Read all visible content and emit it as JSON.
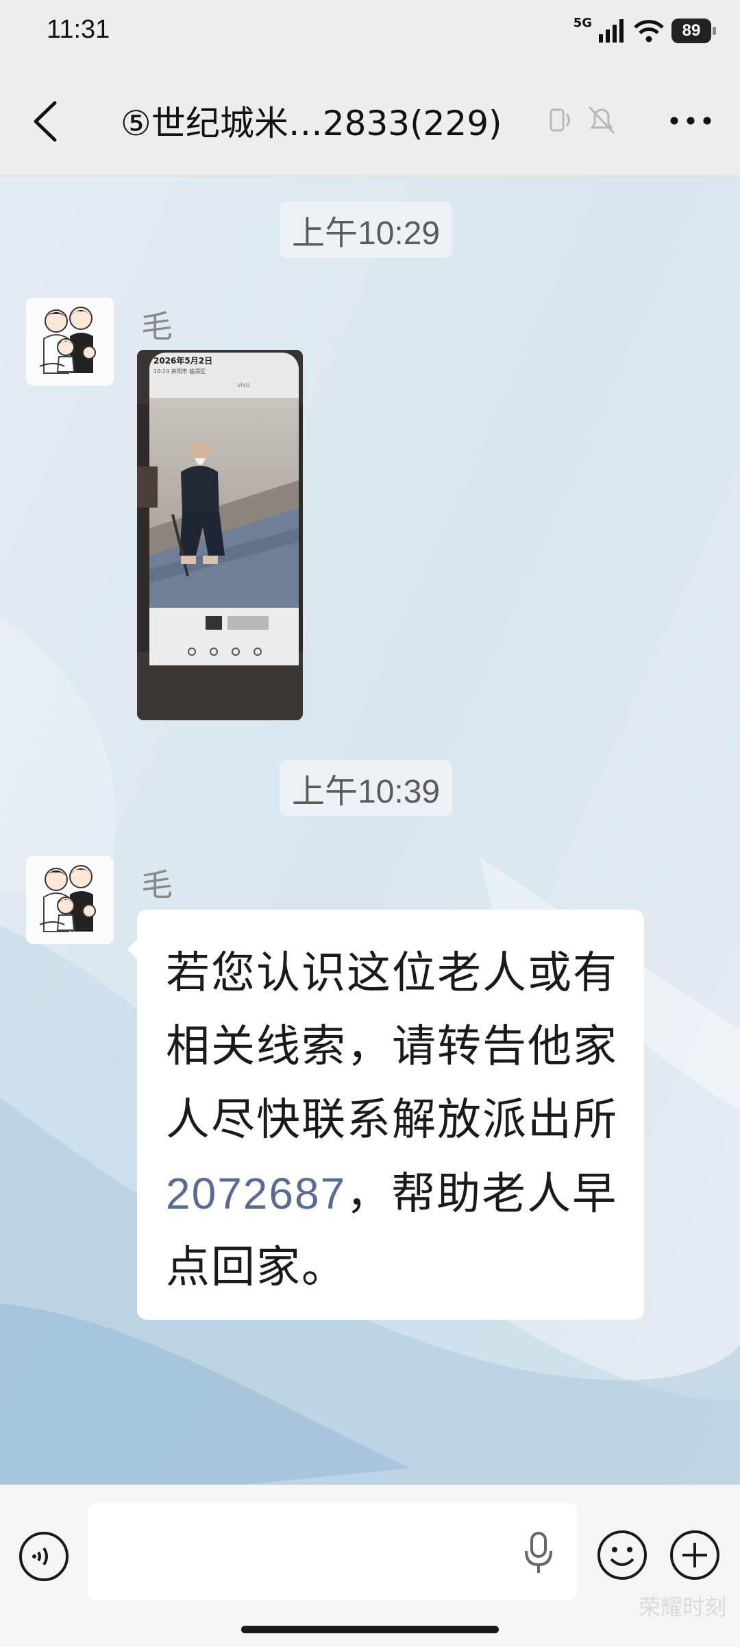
{
  "status_bar": {
    "time": "11:31",
    "network": "5G",
    "battery": "89"
  },
  "header": {
    "title": "⑤世纪城米…2833(229)"
  },
  "messages": [
    {
      "time": "上午10:29",
      "sender": "毛",
      "type": "image"
    },
    {
      "time": "上午10:39",
      "sender": "毛",
      "type": "text",
      "text_before": "若您认识这位老人或有相关线索，请转告他家人尽快联系解放派出所",
      "phone": "2072687",
      "text_after": "，帮助老人早点回家。"
    }
  ],
  "photo_overlay": {
    "date": "2026年5月2日",
    "subline": "10:24 资阳市 临渭区",
    "watermark": "vivo"
  },
  "input": {
    "value": "",
    "placeholder": ""
  },
  "watermark": "荣耀时刻",
  "colors": {
    "header_bg": "#ededed",
    "link": "#576b95",
    "bubble": "#ffffff"
  },
  "icons": [
    "back-arrow-icon",
    "voice-call-icon",
    "mute-bell-icon",
    "more-icon",
    "voice-input-icon",
    "microphone-icon",
    "emoji-icon",
    "plus-icon"
  ]
}
